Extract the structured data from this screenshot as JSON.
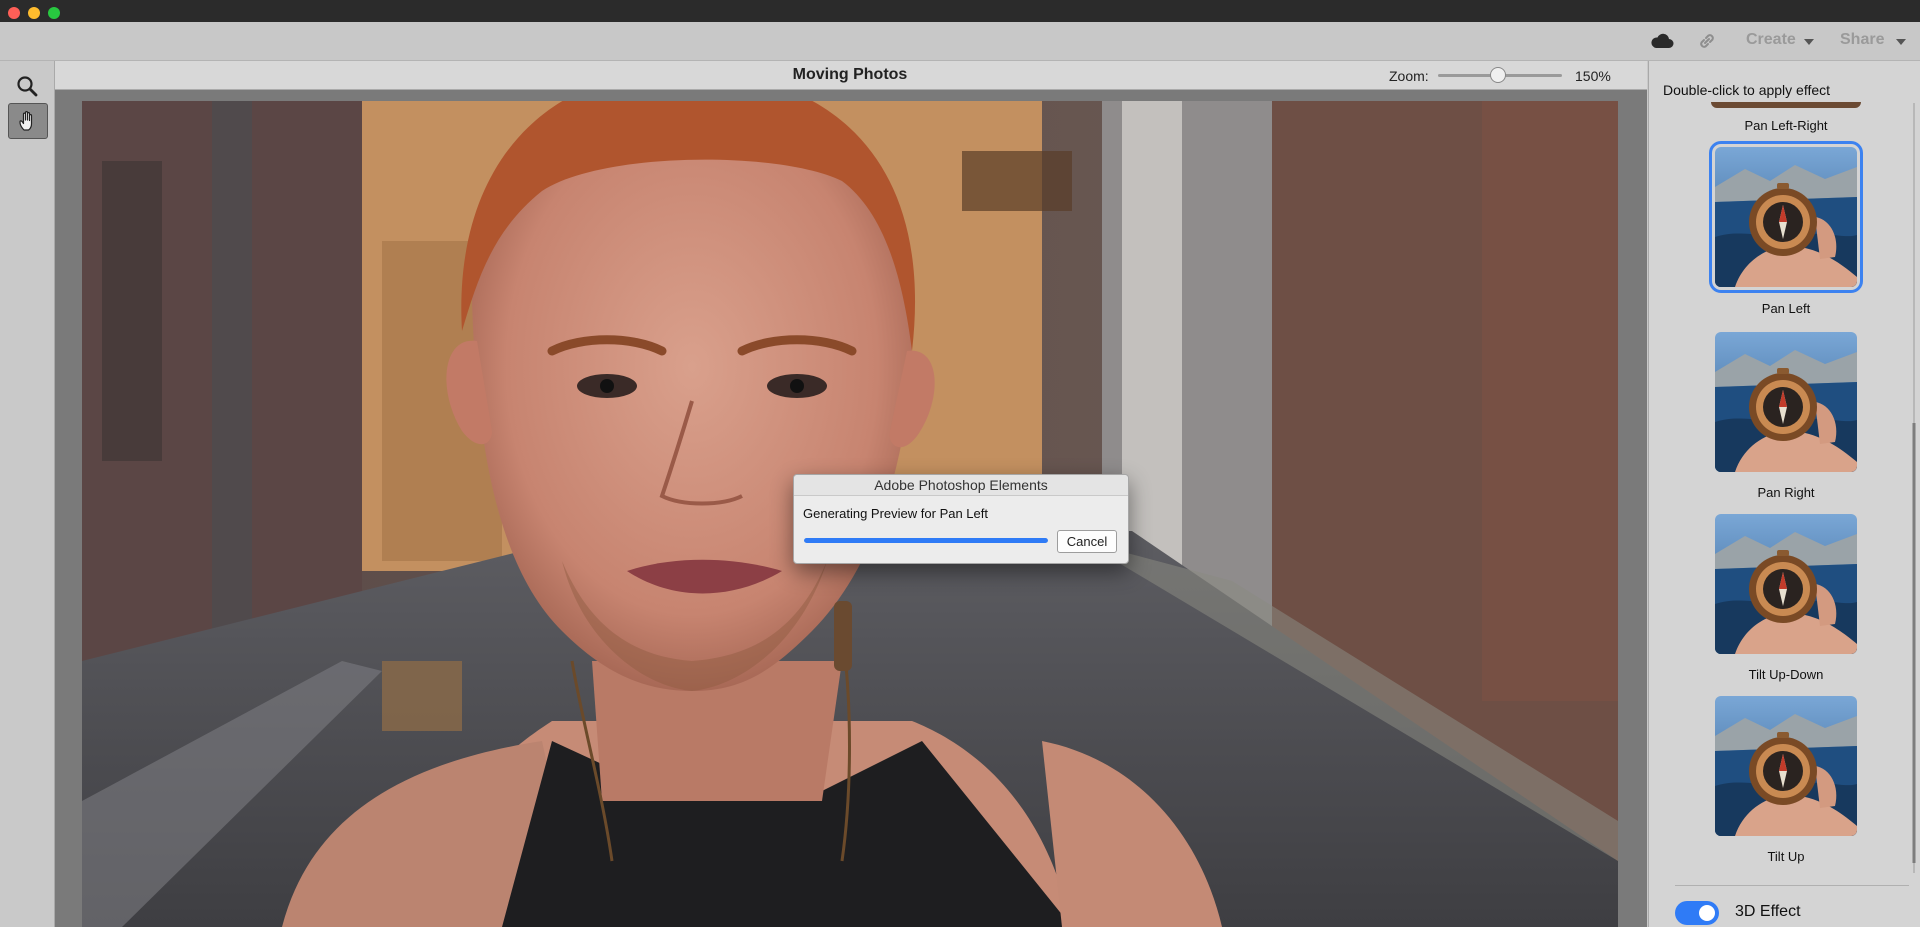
{
  "window": {
    "traffic_lights": [
      "close",
      "minimize",
      "zoom"
    ]
  },
  "topbar": {
    "cloud_icon": "cloud-icon",
    "link_icon": "link-icon",
    "create_label": "Create",
    "share_label": "Share"
  },
  "tools": [
    {
      "name": "zoom-tool",
      "icon": "magnifier-icon",
      "active": false
    },
    {
      "name": "hand-tool",
      "icon": "hand-icon",
      "active": true
    }
  ],
  "document": {
    "title": "Moving Photos",
    "zoom_label": "Zoom:",
    "zoom_value": "150%"
  },
  "dialog": {
    "title": "Adobe Photoshop Elements",
    "message": "Generating Preview for Pan Left",
    "progress": 1.0,
    "cancel_label": "Cancel"
  },
  "panel": {
    "hint": "Double-click to apply effect",
    "effects": [
      {
        "label": "Pan Left-Right",
        "selected": false
      },
      {
        "label": "Pan Left",
        "selected": true
      },
      {
        "label": "Pan Right",
        "selected": false
      },
      {
        "label": "Tilt Up-Down",
        "selected": false
      },
      {
        "label": "Tilt Up",
        "selected": false
      }
    ],
    "toggle_label": "3D Effect",
    "toggle_on": true
  },
  "colors": {
    "accent": "#2f7bf6",
    "selection": "#3c82f0"
  }
}
